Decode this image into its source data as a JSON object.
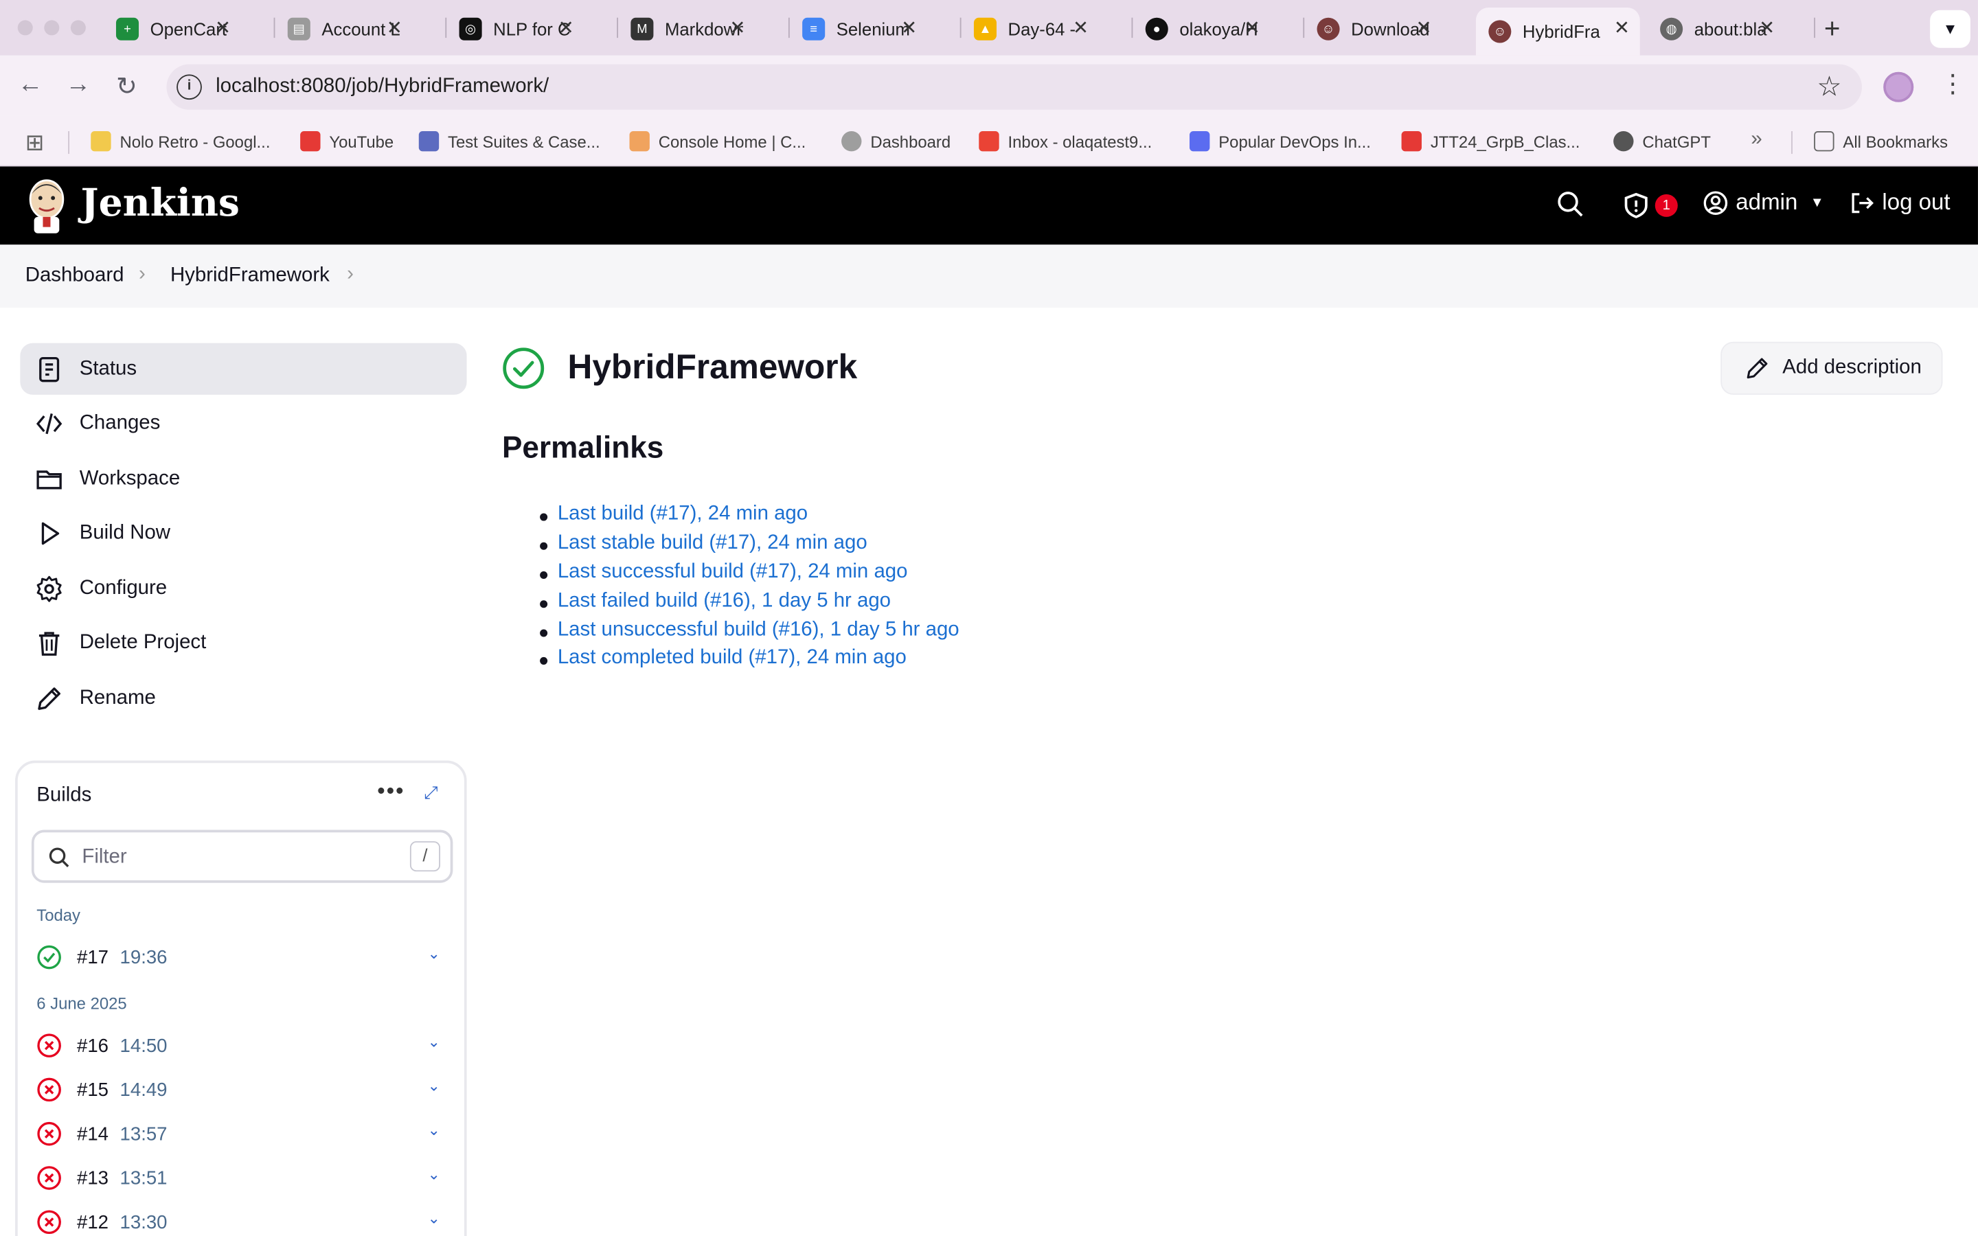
{
  "browser": {
    "tabs": [
      {
        "label": "OpenCart",
        "color": "#1e8e3e",
        "glyph": "+"
      },
      {
        "label": "Account L",
        "color": "#8a8a8a",
        "glyph": "🛒"
      },
      {
        "label": "NLP for C",
        "color": "#111111",
        "glyph": "◎"
      },
      {
        "label": "Markdown",
        "color": "#333333",
        "glyph": "M"
      },
      {
        "label": "Selenium",
        "color": "#4285f4",
        "glyph": "≡"
      },
      {
        "label": "Day-64 -",
        "color": "#f4b400",
        "glyph": "▲"
      },
      {
        "label": "olakoya/H",
        "color": "#111111",
        "glyph": "●"
      },
      {
        "label": "Download",
        "color": "#7a3b3b",
        "glyph": "☺"
      },
      {
        "label": "HybridFra",
        "color": "#7a3b3b",
        "glyph": "☺"
      },
      {
        "label": "about:bla",
        "color": "#666666",
        "glyph": "◍"
      }
    ],
    "url": "localhost:8080/job/HybridFramework/",
    "bookmarks": [
      {
        "label": "Nolo Retro - Googl...",
        "color": "#f2c94c"
      },
      {
        "label": "YouTube",
        "color": "#e53935"
      },
      {
        "label": "Test Suites & Case...",
        "color": "#5c6bc0"
      },
      {
        "label": "Console Home | C...",
        "color": "#f0a35e"
      },
      {
        "label": "Dashboard",
        "color": "#9e9e9e"
      },
      {
        "label": "Inbox - olaqatest9...",
        "color": "#ea4335"
      },
      {
        "label": "Popular DevOps In...",
        "color": "#5b6cf0"
      },
      {
        "label": "JTT24_GrpB_Clas...",
        "color": "#e53935"
      },
      {
        "label": "ChatGPT",
        "color": "#555555"
      }
    ],
    "all_bookmarks": "All Bookmarks",
    "overflow": "»"
  },
  "header": {
    "brand": "Jenkins",
    "notifications": "1",
    "user": "admin",
    "logout": "log out"
  },
  "breadcrumb": {
    "items": [
      "Dashboard",
      "HybridFramework"
    ]
  },
  "sidebar": {
    "items": [
      {
        "label": "Status"
      },
      {
        "label": "Changes"
      },
      {
        "label": "Workspace"
      },
      {
        "label": "Build Now"
      },
      {
        "label": "Configure"
      },
      {
        "label": "Delete Project"
      },
      {
        "label": "Rename"
      }
    ]
  },
  "builds": {
    "title": "Builds",
    "filter_placeholder": "Filter",
    "filter_shortcut": "/",
    "groups": [
      {
        "label": "Today",
        "rows": [
          {
            "num": "#17",
            "time": "19:36",
            "status": "success"
          }
        ]
      },
      {
        "label": "6 June 2025",
        "rows": [
          {
            "num": "#16",
            "time": "14:50",
            "status": "failed"
          },
          {
            "num": "#15",
            "time": "14:49",
            "status": "failed"
          },
          {
            "num": "#14",
            "time": "13:57",
            "status": "failed"
          },
          {
            "num": "#13",
            "time": "13:51",
            "status": "failed"
          },
          {
            "num": "#12",
            "time": "13:30",
            "status": "failed"
          }
        ]
      }
    ]
  },
  "main": {
    "title": "HybridFramework",
    "add_description": "Add description",
    "permalinks_heading": "Permalinks",
    "permalinks": [
      "Last build (#17), 24 min ago",
      "Last stable build (#17), 24 min ago",
      "Last successful build (#17), 24 min ago",
      "Last failed build (#16), 1 day 5 hr ago",
      "Last unsuccessful build (#16), 1 day 5 hr ago",
      "Last completed build (#17), 24 min ago"
    ]
  },
  "colors": {
    "success": "#1ea446",
    "failed": "#e6001f",
    "link": "#1b6fd1",
    "header_bg": "#000000"
  }
}
